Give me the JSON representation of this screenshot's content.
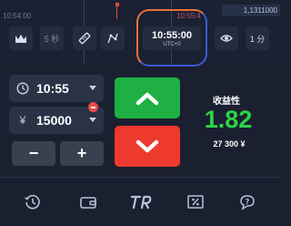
{
  "chart": {
    "time_left": "10:54:00",
    "time_right": "10:55:4",
    "price_value": "1,1311000"
  },
  "toolbar": {
    "candle_icon": "mountain-chart-icon",
    "seconds_label": "5 秒",
    "ruler_icon": "ruler-icon",
    "draw_icon": "line-tool-icon",
    "eye_icon": "eye-icon",
    "minutes_label": "1 分"
  },
  "clock": {
    "time": "10:55:00",
    "timezone": "UTC+0"
  },
  "order": {
    "expiry_time": "10:55",
    "currency_symbol": "¥",
    "amount": "15000",
    "minus_label": "−",
    "plus_label": "+"
  },
  "payout": {
    "label": "收益性",
    "multiplier": "1.82",
    "amount": "27 300 ¥"
  },
  "colors": {
    "up": "#1eb043",
    "down": "#ee3a2e",
    "payout": "#2bd548",
    "background": "#1b2030"
  },
  "bottom_nav": [
    "history-icon",
    "wallet-icon",
    "trader-room-logo-icon",
    "discount-icon",
    "support-chat-icon"
  ]
}
